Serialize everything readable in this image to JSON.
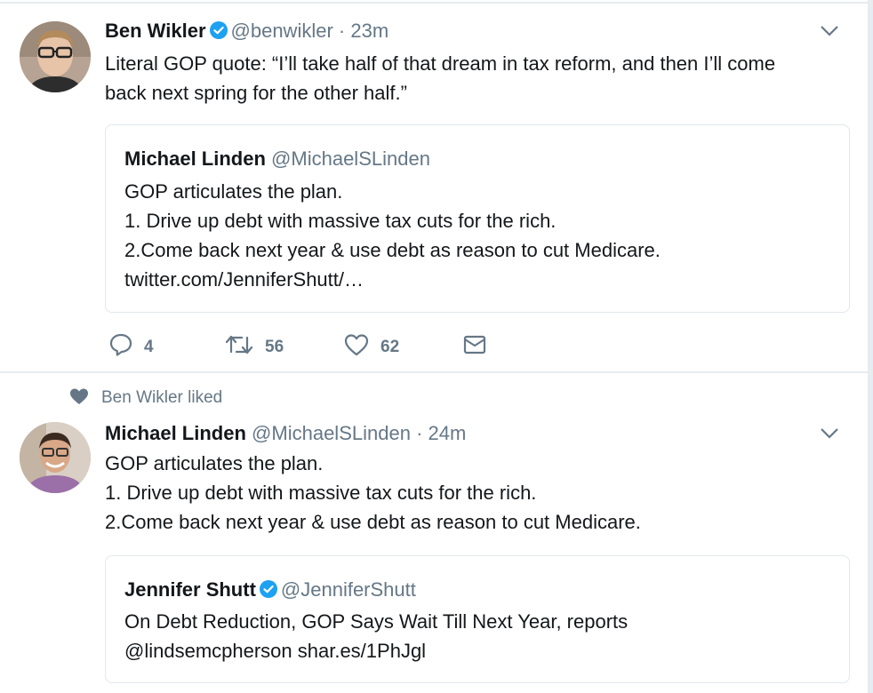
{
  "tweet1": {
    "name": "Ben Wikler",
    "handle": "@benwikler",
    "separator": "·",
    "time": "23m",
    "lines": [
      "Literal GOP quote: “I’ll take half of that dream in tax reform, and then I’ll come",
      "back next spring for the other half.”"
    ],
    "quote": {
      "name": "Michael Linden",
      "handle": "@MichaelSLinden",
      "lines": [
        "GOP articulates the plan.",
        "1. Drive up debt with massive tax cuts for the rich.",
        "2.Come back next year & use debt as reason to cut Medicare.",
        "twitter.com/JenniferShutt/…"
      ]
    },
    "actions": {
      "replies": "4",
      "retweets": "56",
      "likes": "62"
    }
  },
  "liked_notice": "Ben Wikler liked",
  "tweet2": {
    "name": "Michael Linden",
    "handle": "@MichaelSLinden",
    "separator": "·",
    "time": "24m",
    "lines": [
      "GOP articulates the plan.",
      "1. Drive up debt with massive tax cuts for the rich.",
      "2.Come back next year & use debt as reason to cut Medicare."
    ],
    "quote": {
      "name": "Jennifer Shutt",
      "handle": "@JenniferShutt",
      "lines": [
        "On Debt Reduction, GOP Says Wait Till Next Year, reports",
        "@lindsemcpherson shar.es/1PhJgl"
      ]
    }
  },
  "icons": {
    "verified": "verified-badge-icon",
    "chevron": "chevron-down-icon",
    "reply": "reply-icon",
    "retweet": "retweet-icon",
    "like": "heart-icon",
    "dm": "envelope-icon",
    "liked": "heart-filled-icon"
  },
  "colors": {
    "verified": "#1da1f2",
    "muted": "#657786",
    "border": "#e1e8ed",
    "text": "#14171a"
  }
}
